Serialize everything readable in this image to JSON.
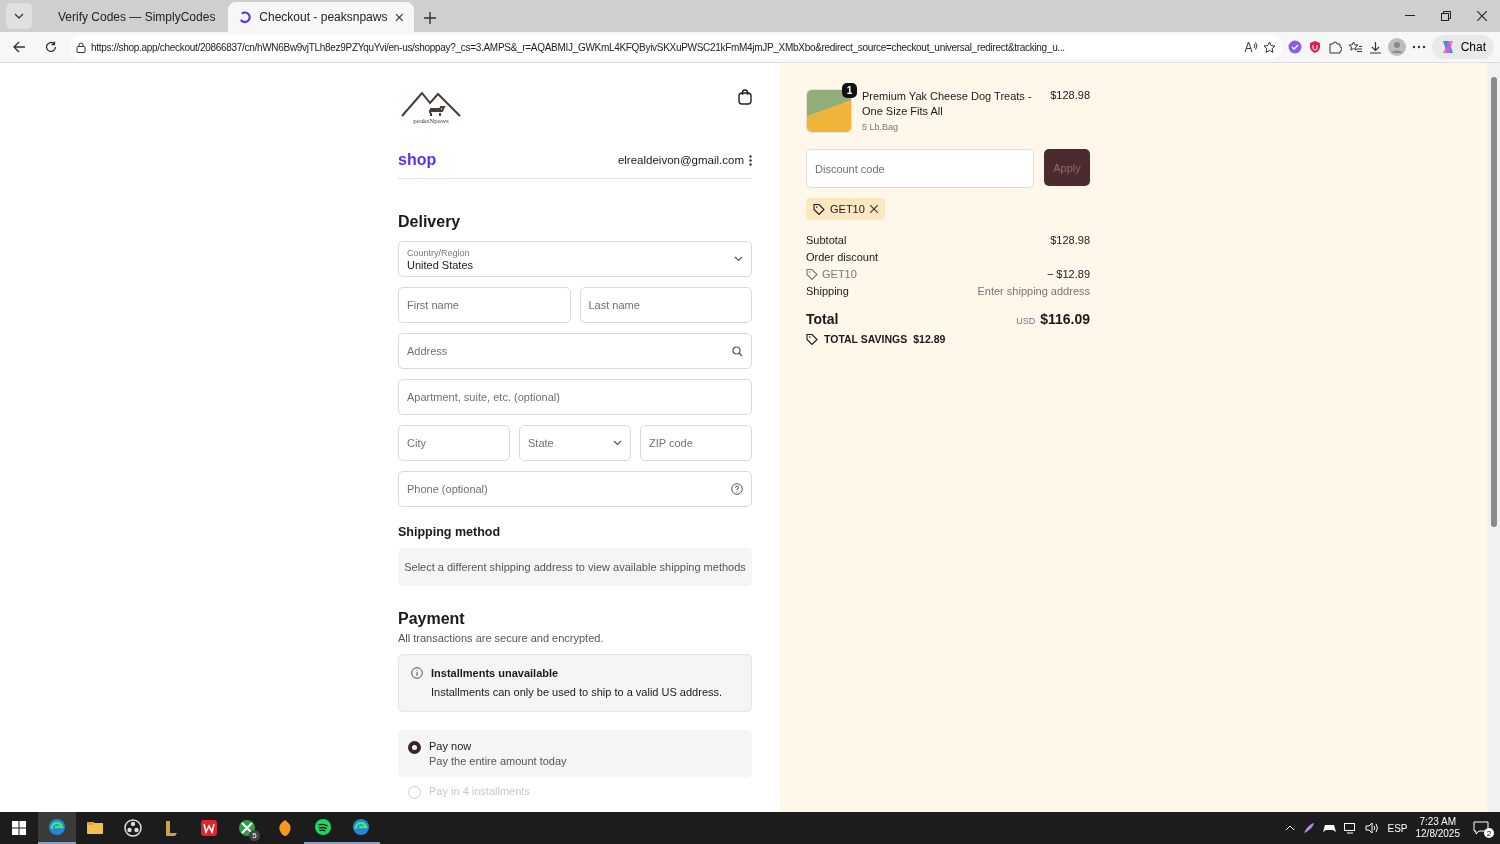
{
  "browser": {
    "tabs": [
      {
        "title": "Verify Codes — SimplyCodes",
        "kind": "leaf",
        "selected": false
      },
      {
        "title": "Checkout - peaksnpaws",
        "kind": "shop",
        "selected": true
      }
    ],
    "url": "https://shop.app/checkout/20866837/cn/hWN6Bw9vjTLh8ez9PZYquYvi/en-us/shoppay?_cs=3.AMPS&_r=AQABMIJ_GWKmL4KFQByivSKXuPWSC21kFmM4jmJP_XMbXbo&redirect_source=checkout_universal_redirect&tracking_u...",
    "chat_label": "Chat"
  },
  "checkout": {
    "logo_text": "peaksNpaws",
    "shop_label": "shop",
    "email": "elrealdeivon@gmail.com",
    "delivery": {
      "heading": "Delivery",
      "rows": [
        [
          {
            "kind": "select",
            "label": "Country/Region",
            "value": "United States"
          }
        ],
        [
          {
            "kind": "input",
            "placeholder": "First name"
          },
          {
            "kind": "input",
            "placeholder": "Last name"
          }
        ],
        [
          {
            "kind": "search",
            "placeholder": "Address"
          }
        ],
        [
          {
            "kind": "input",
            "placeholder": "Apartment, suite, etc. (optional)"
          }
        ],
        [
          {
            "kind": "input",
            "placeholder": "City"
          },
          {
            "kind": "select",
            "placeholder": "State"
          },
          {
            "kind": "input",
            "placeholder": "ZIP code"
          }
        ],
        [
          {
            "kind": "help",
            "placeholder": "Phone (optional)"
          }
        ]
      ]
    },
    "shipping": {
      "heading": "Shipping method",
      "notice": "Select a different shipping address to view available shipping methods"
    },
    "payment": {
      "heading": "Payment",
      "subtitle": "All transactions are secure and encrypted.",
      "notice": {
        "title": "Installments unavailable",
        "text": "Installments can only be used to ship to a valid US address."
      },
      "options": [
        {
          "title": "Pay now",
          "subtitle": "Pay the entire amount today",
          "selected": true,
          "disabled": false
        },
        {
          "title": "Pay in 4 installments",
          "selected": false,
          "disabled": true
        }
      ]
    }
  },
  "summary": {
    "item": {
      "name": "Premium Yak Cheese Dog Treats - One Size Fits All",
      "variant": "5 Lb.Bag",
      "price": "$128.98",
      "quantity": "1"
    },
    "discount": {
      "placeholder": "Discount code",
      "button": "Apply",
      "disabled": true,
      "code": "GET10"
    },
    "lines": [
      {
        "kind": "plain",
        "label": "Subtotal",
        "value": "$128.98"
      },
      {
        "kind": "plain",
        "label": "Order discount"
      },
      {
        "kind": "code",
        "label": "GET10",
        "value": "− $12.89"
      },
      {
        "kind": "muted",
        "label": "Shipping",
        "value": "Enter shipping address"
      }
    ],
    "total": {
      "label": "Total",
      "currency": "USD",
      "amount": "$116.09"
    },
    "savings": {
      "label": "TOTAL SAVINGS",
      "amount": "$12.89"
    }
  },
  "taskbar": {
    "apps": [
      {
        "kind": "edge",
        "active": true
      },
      {
        "kind": "folder",
        "active": false
      },
      {
        "kind": "obs",
        "active": false
      },
      {
        "kind": "lol",
        "active": false
      },
      {
        "kind": "wps",
        "active": false
      },
      {
        "kind": "xbox",
        "active": false,
        "badge": "5"
      },
      {
        "kind": "fl",
        "active": false
      },
      {
        "kind": "spotify",
        "active": true
      },
      {
        "kind": "edge",
        "active": true
      }
    ],
    "language": "ESP",
    "time": "7:23 AM",
    "date": "12/8/2025",
    "notifications": "2"
  }
}
